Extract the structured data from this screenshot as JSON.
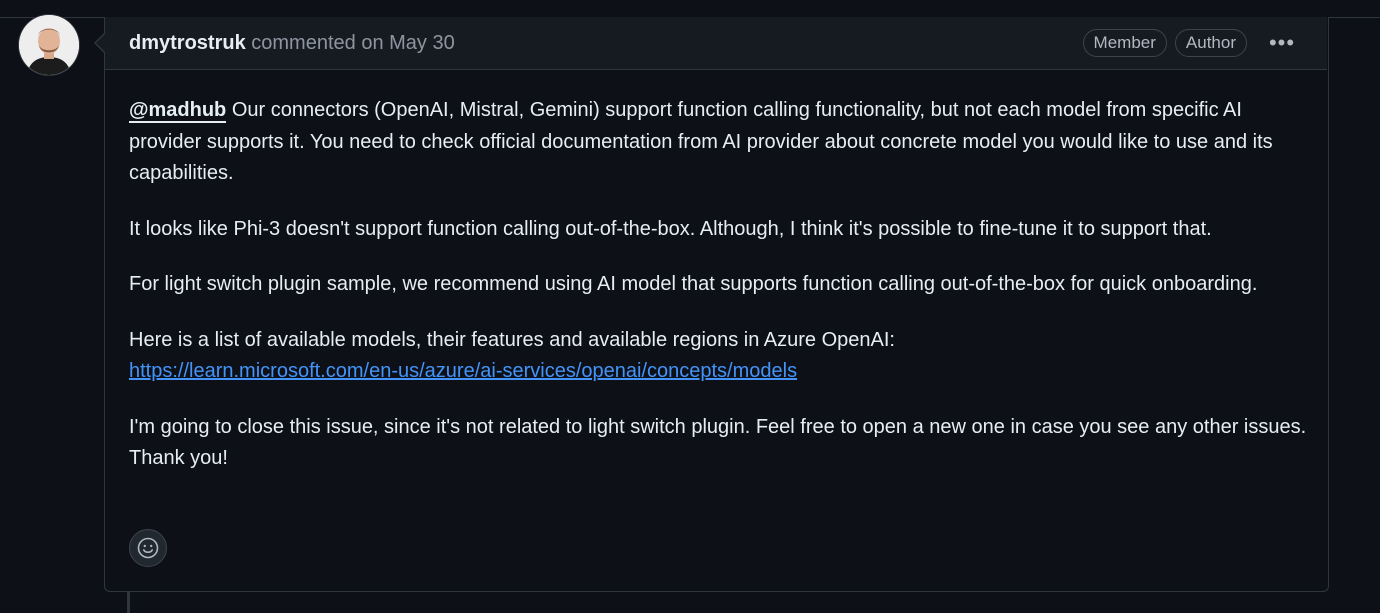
{
  "comment": {
    "author": "dmytrostruk",
    "meta": "commented on May 30",
    "badges": [
      "Member",
      "Author"
    ],
    "menu_glyph": "•••",
    "body": {
      "p1_mention": "@madhub",
      "p1_text": " Our connectors (OpenAI, Mistral, Gemini) support function calling functionality, but not each model from specific AI provider supports it. You need to check official documentation from AI provider about concrete model you would like to use and its capabilities.",
      "p2": "It looks like Phi-3 doesn't support function calling out-of-the-box. Although, I think it's possible to fine-tune it to support that.",
      "p3": "For light switch plugin sample, we recommend using AI model that supports function calling out-of-the-box for quick onboarding.",
      "p4_text": "Here is a list of available models, their features and available regions in Azure OpenAI:",
      "p4_link": "https://learn.microsoft.com/en-us/azure/ai-services/openai/concepts/models",
      "p5": "I'm going to close this issue, since it's not related to light switch plugin. Feel free to open a new one in case you see any other issues. Thank you!"
    },
    "reaction_icon": "smiley-icon"
  },
  "colors": {
    "background": "#0d1117",
    "header_bg": "#161b22",
    "border": "#30363d",
    "text": "#e6edf3",
    "muted": "#8d96a0",
    "link": "#4493f8"
  }
}
